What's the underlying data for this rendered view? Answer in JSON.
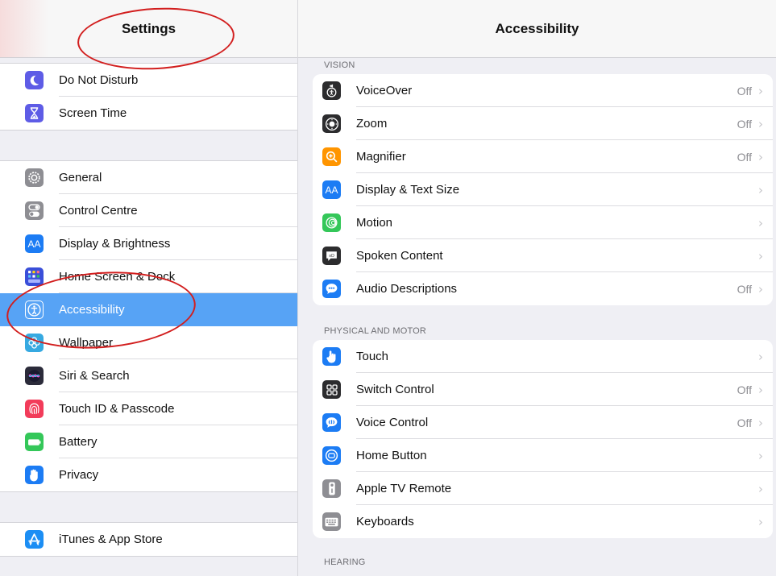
{
  "sidebar": {
    "title": "Settings",
    "group_top": [
      {
        "label": "Do Not Disturb",
        "icon": "moon-icon",
        "color": "#5e5ce6"
      },
      {
        "label": "Screen Time",
        "icon": "hourglass-icon",
        "color": "#5e5ce6"
      }
    ],
    "group_mid": [
      {
        "label": "General",
        "icon": "gear-icon",
        "color": "#8e8e93"
      },
      {
        "label": "Control Centre",
        "icon": "toggle-icon",
        "color": "#8e8e93"
      },
      {
        "label": "Display & Brightness",
        "icon": "text-size-icon",
        "color": "#1c7cf4"
      },
      {
        "label": "Home Screen & Dock",
        "icon": "grid-icon",
        "color": "#3a4fd9"
      },
      {
        "label": "Accessibility",
        "icon": "accessibility-icon",
        "color": "#1c7cf4",
        "selected": true
      },
      {
        "label": "Wallpaper",
        "icon": "flower-icon",
        "color": "#36a9e1"
      },
      {
        "label": "Siri & Search",
        "icon": "siri-icon",
        "color": "#2b2b3a"
      },
      {
        "label": "Touch ID & Passcode",
        "icon": "fingerprint-icon",
        "color": "#f23c5a"
      },
      {
        "label": "Battery",
        "icon": "battery-icon",
        "color": "#34c759"
      },
      {
        "label": "Privacy",
        "icon": "hand-icon",
        "color": "#1c7cf4"
      }
    ],
    "group_bottom": [
      {
        "label": "iTunes & App Store",
        "icon": "app-store-icon",
        "color": "#1c8ef4"
      }
    ]
  },
  "main": {
    "title": "Accessibility",
    "sections": [
      {
        "label": "VISION",
        "items": [
          {
            "label": "VoiceOver",
            "value": "Off",
            "icon": "voiceover-icon",
            "color": "#2c2c2e"
          },
          {
            "label": "Zoom",
            "value": "Off",
            "icon": "zoom-icon",
            "color": "#2c2c2e"
          },
          {
            "label": "Magnifier",
            "value": "Off",
            "icon": "magnifier-icon",
            "color": "#ff9500"
          },
          {
            "label": "Display & Text Size",
            "value": "",
            "icon": "text-size-icon",
            "color": "#1c7cf4"
          },
          {
            "label": "Motion",
            "value": "",
            "icon": "motion-icon",
            "color": "#34c759"
          },
          {
            "label": "Spoken Content",
            "value": "",
            "icon": "speech-icon",
            "color": "#2c2c2e"
          },
          {
            "label": "Audio Descriptions",
            "value": "Off",
            "icon": "audio-description-icon",
            "color": "#1c7cf4"
          }
        ]
      },
      {
        "label": "PHYSICAL AND MOTOR",
        "items": [
          {
            "label": "Touch",
            "value": "",
            "icon": "touch-icon",
            "color": "#1c7cf4"
          },
          {
            "label": "Switch Control",
            "value": "Off",
            "icon": "switch-control-icon",
            "color": "#2c2c2e"
          },
          {
            "label": "Voice Control",
            "value": "Off",
            "icon": "voice-control-icon",
            "color": "#1c7cf4"
          },
          {
            "label": "Home Button",
            "value": "",
            "icon": "home-button-icon",
            "color": "#1c7cf4"
          },
          {
            "label": "Apple TV Remote",
            "value": "",
            "icon": "remote-icon",
            "color": "#8e8e93"
          },
          {
            "label": "Keyboards",
            "value": "",
            "icon": "keyboard-icon",
            "color": "#8e8e93"
          }
        ]
      },
      {
        "label": "HEARING",
        "items": []
      }
    ],
    "chevron": "›"
  },
  "annotations": {
    "color": "#d21e1e"
  }
}
